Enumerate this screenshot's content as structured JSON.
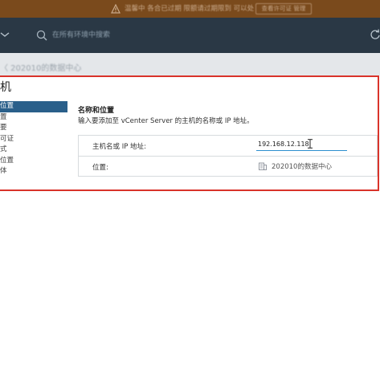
{
  "banner": {
    "text": "温馨中 各合已过期 限额请过期限到 可以处",
    "button_label": "查看许可证 管理"
  },
  "header": {
    "search_placeholder": "在所有环境中搜索"
  },
  "background_title": "〈 202010的数据中心",
  "dialog": {
    "title": "机",
    "steps": [
      {
        "label": "位置",
        "active": true
      },
      {
        "label": "置",
        "active": false
      },
      {
        "label": "要",
        "active": false
      },
      {
        "label": "可证",
        "active": false
      },
      {
        "label": "式",
        "active": false
      },
      {
        "label": "位置",
        "active": false
      },
      {
        "label": "体",
        "active": false
      }
    ],
    "section_title": "名称和位置",
    "section_desc": "输入要添加至 vCenter Server 的主机的名称或 IP 地址。",
    "form": {
      "host_label": "主机名或 IP 地址:",
      "host_value": "192.168.12.118",
      "location_label": "位置:",
      "location_value": "202010的数据中心"
    }
  },
  "colors": {
    "banner_bg": "#7a4a1c",
    "header_bg": "#2a3845",
    "highlight_border": "#d9332a",
    "active_step_bg": "#2a5f8a",
    "input_underline": "#2d8fce"
  }
}
